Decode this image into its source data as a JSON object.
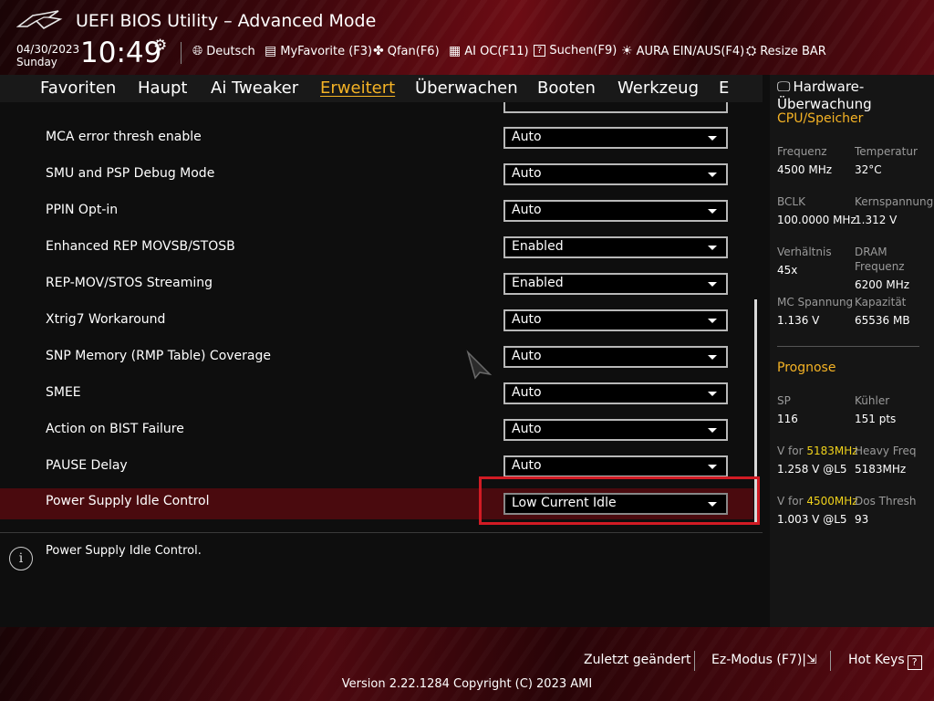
{
  "header": {
    "title": "UEFI BIOS Utility – Advanced Mode",
    "date": "04/30/2023",
    "day": "Sunday",
    "time": "10:49",
    "toolbar": [
      {
        "icon": "globe-icon",
        "label": "Deutsch"
      },
      {
        "icon": "favorite-icon",
        "label": "MyFavorite (F3)"
      },
      {
        "icon": "fan-icon",
        "label": "Qfan(F6)"
      },
      {
        "icon": "ai-chip-icon",
        "label": "AI OC(F11)"
      },
      {
        "icon": "search-help-icon",
        "label": "Suchen(F9)"
      },
      {
        "icon": "aura-light-icon",
        "label": "AURA EIN/AUS(F4)"
      },
      {
        "icon": "resize-bar-icon",
        "label": "Resize BAR"
      }
    ]
  },
  "nav": {
    "tabs": [
      "Favoriten",
      "Haupt",
      "Ai Tweaker",
      "Erweitert",
      "Überwachen",
      "Booten",
      "Werkzeug",
      "E"
    ],
    "active": "Erweitert"
  },
  "settings": [
    {
      "label": "MCA error thresh enable",
      "value": "Auto"
    },
    {
      "label": "SMU and PSP Debug Mode",
      "value": "Auto"
    },
    {
      "label": "PPIN Opt-in",
      "value": "Auto"
    },
    {
      "label": "Enhanced REP MOVSB/STOSB",
      "value": "Enabled"
    },
    {
      "label": "REP-MOV/STOS Streaming",
      "value": "Enabled"
    },
    {
      "label": "Xtrig7 Workaround",
      "value": "Auto"
    },
    {
      "label": "SNP Memory (RMP Table) Coverage",
      "value": "Auto"
    },
    {
      "label": "SMEE",
      "value": "Auto"
    },
    {
      "label": "Action on BIST Failure",
      "value": "Auto"
    },
    {
      "label": "PAUSE Delay",
      "value": "Auto"
    },
    {
      "label": "Power Supply Idle Control",
      "value": "Low Current Idle",
      "selected": true
    }
  ],
  "help": {
    "text": "Power Supply Idle Control."
  },
  "sidebar": {
    "title": "Hardware-Überwachung",
    "cpu_section": "CPU/Speicher",
    "cpu": {
      "freq_label": "Frequenz",
      "freq_value": "4500 MHz",
      "temp_label": "Temperatur",
      "temp_value": "32°C",
      "bclk_label": "BCLK",
      "bclk_value": "100.0000 MHz",
      "core_v_label": "Kernspannung",
      "core_v_value": "1.312 V",
      "ratio_label": "Verhältnis",
      "ratio_value": "45x",
      "dram_label": "DRAM Frequenz",
      "dram_value": "6200 MHz",
      "mc_label": "MC Spannung",
      "mc_value": "1.136 V",
      "cap_label": "Kapazität",
      "cap_value": "65536 MB"
    },
    "prognose_section": "Prognose",
    "prognose": {
      "sp_label": "SP",
      "sp_value": "116",
      "cooler_label": "Kühler",
      "cooler_value": "151 pts",
      "vfor1_prefix": "V for ",
      "vfor1_freq": "5183MHz",
      "vfor1_value": "1.258 V @L5",
      "heavy_label": "Heavy Freq",
      "heavy_value": "5183MHz",
      "vfor2_prefix": "V for ",
      "vfor2_freq": "4500MHz",
      "vfor2_value": "1.003 V @L5",
      "dos_label": "Dos Thresh",
      "dos_value": "93"
    }
  },
  "footer": {
    "last_changed": "Zuletzt geändert",
    "ez_mode": "Ez-Modus (F7)",
    "hot_keys": "Hot Keys",
    "hot_keys_icon": "?",
    "version": "Version 2.22.1284 Copyright (C) 2023 AMI"
  },
  "colors": {
    "accent": "#f5b325",
    "selected_row": "#4a0a0e",
    "highlight_box": "#d11b24",
    "value_highlight": "#f0d21b"
  }
}
